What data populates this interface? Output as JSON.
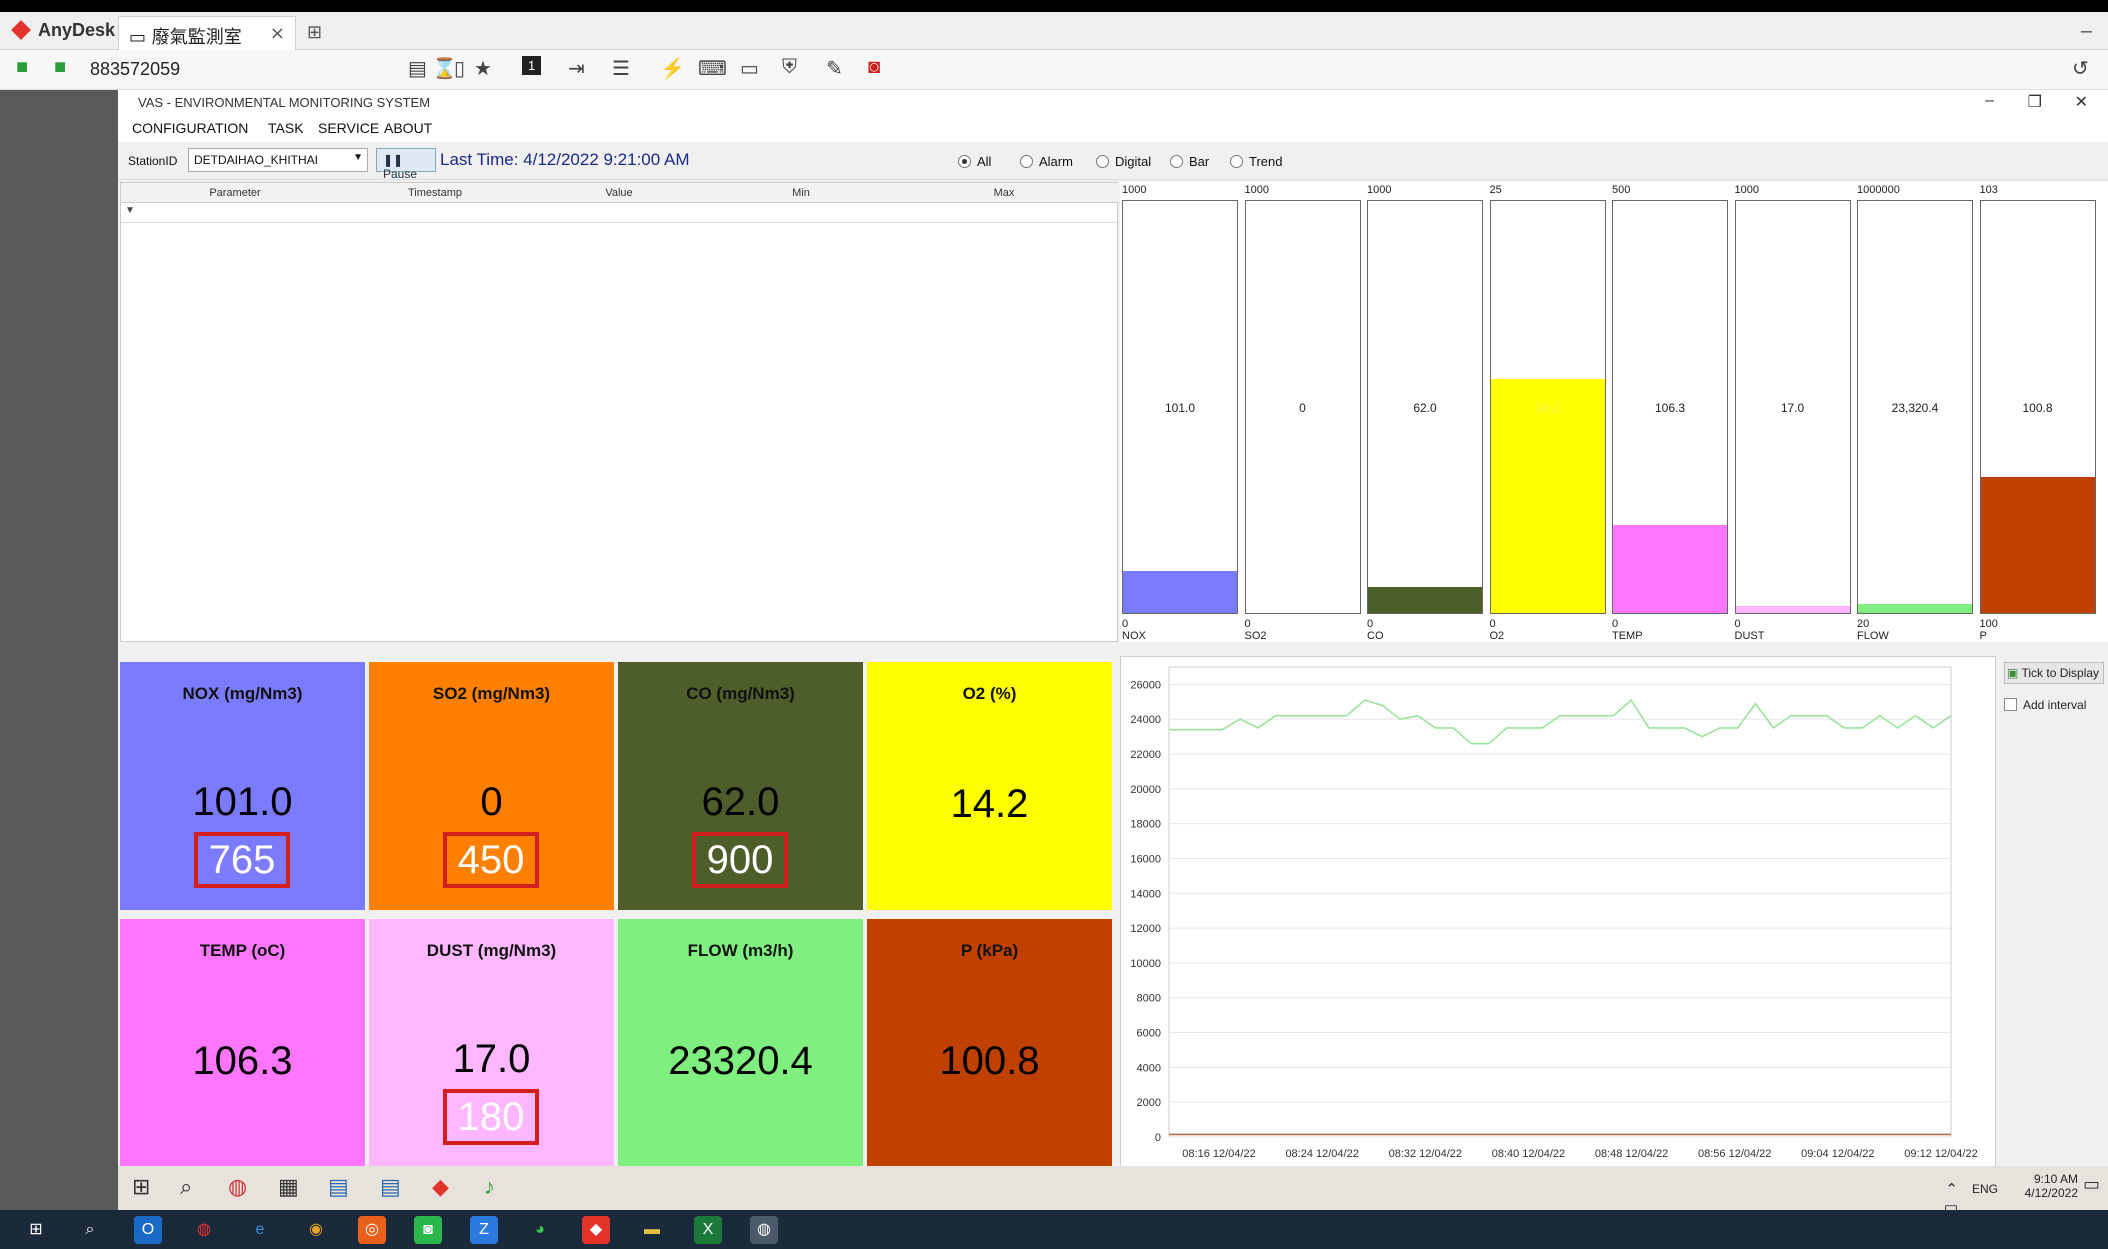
{
  "anydesk": {
    "app_name": "AnyDesk",
    "tab_title": "廢氣監測室",
    "tab_close": "×",
    "new_tab": "⊞",
    "address": "883572059",
    "minimize": "–"
  },
  "app": {
    "title": "VAS - ENVIRONMENTAL MONITORING SYSTEM",
    "menu": [
      "CONFIGURATION",
      "TASK",
      "SERVICE",
      "ABOUT"
    ],
    "station_label": "StationID",
    "station_value": "DETDAIHAO_KHITHAI",
    "pause_label": "Pause",
    "last_time": "Last Time: 4/12/2022 9:21:00 AM",
    "radios": [
      {
        "label": "All",
        "checked": true
      },
      {
        "label": "Alarm",
        "checked": false
      },
      {
        "label": "Digital",
        "checked": false
      },
      {
        "label": "Bar",
        "checked": false
      },
      {
        "label": "Trend",
        "checked": false
      }
    ]
  },
  "grid": {
    "columns": [
      "Parameter",
      "Timestamp",
      "Value",
      "Min",
      "Max"
    ],
    "filter_icon": "▼"
  },
  "bars": [
    {
      "name": "NOX",
      "max": "1000",
      "min": "0",
      "value": "101.0",
      "fraction": 0.101,
      "color": "#7b7bff"
    },
    {
      "name": "SO2",
      "max": "1000",
      "min": "0",
      "value": "0",
      "fraction": 0,
      "color": "#ff8000"
    },
    {
      "name": "CO",
      "max": "1000",
      "min": "0",
      "value": "62.0",
      "fraction": 0.062,
      "color": "#4e5e2a"
    },
    {
      "name": "O2",
      "max": "25",
      "min": "0",
      "value": "14.2",
      "fraction": 0.568,
      "color": "#ffff00"
    },
    {
      "name": "TEMP",
      "max": "500",
      "min": "0",
      "value": "106.3",
      "fraction": 0.213,
      "color": "#ff77ff"
    },
    {
      "name": "DUST",
      "max": "1000",
      "min": "0",
      "value": "17.0",
      "fraction": 0.017,
      "color": "#ffb7ff"
    },
    {
      "name": "FLOW",
      "max": "1000000",
      "min": "20",
      "value": "23,320.4",
      "fraction": 0.023,
      "color": "#7ff07f"
    },
    {
      "name": "P",
      "max": "103",
      "min": "100",
      "value": "100.8",
      "fraction": 0.33,
      "color": "#c04000"
    }
  ],
  "tiles": [
    {
      "title": "NOX (mg/Nm3)",
      "value": "101.0",
      "limit": "765",
      "color": "#7b7bff"
    },
    {
      "title": "SO2 (mg/Nm3)",
      "value": "0",
      "limit": "450",
      "color": "#ff8000"
    },
    {
      "title": "CO (mg/Nm3)",
      "value": "62.0",
      "limit": "900",
      "color": "#4e5e2a"
    },
    {
      "title": "O2 (%)",
      "value": "14.2",
      "limit": "",
      "color": "#ffff00"
    },
    {
      "title": "TEMP (oC)",
      "value": "106.3",
      "limit": "",
      "color": "#ff77ff"
    },
    {
      "title": "DUST (mg/Nm3)",
      "value": "17.0",
      "limit": "180",
      "color": "#ffb7ff"
    },
    {
      "title": "FLOW (m3/h)",
      "value": "23320.4",
      "limit": "",
      "color": "#7ff07f"
    },
    {
      "title": "P (kPa)",
      "value": "100.8",
      "limit": "",
      "color": "#c04000"
    }
  ],
  "trend": {
    "tick_to_display": "Tick to Display",
    "add_interval": "Add interval"
  },
  "chart_data": {
    "type": "line",
    "ylim": [
      0,
      27000
    ],
    "y_ticks": [
      "0",
      "2000",
      "4000",
      "6000",
      "8000",
      "10000",
      "12000",
      "14000",
      "16000",
      "18000",
      "20000",
      "22000",
      "24000",
      "26000"
    ],
    "x_ticks": [
      "08:16 12/04/22",
      "08:24 12/04/22",
      "08:32 12/04/22",
      "08:40 12/04/22",
      "08:48 12/04/22",
      "08:56 12/04/22",
      "09:04 12/04/22",
      "09:12 12/04/22"
    ],
    "series": [
      {
        "color": "#9be39b",
        "values": [
          23400,
          23400,
          23400,
          23400,
          24000,
          23500,
          24200,
          24200,
          24200,
          24200,
          24200,
          25100,
          24800,
          24000,
          24200,
          23500,
          23500,
          22600,
          22600,
          23500,
          23500,
          23500,
          24200,
          24200,
          24200,
          24200,
          25100,
          23500,
          23500,
          23500,
          23000,
          23500,
          23500,
          24900,
          23500,
          24200,
          24200,
          24200,
          23500,
          23500,
          24200,
          23500,
          24200,
          23500,
          24200
        ]
      },
      {
        "color": "#b86a4a",
        "values": [
          150,
          150,
          150,
          150,
          150,
          150,
          150,
          150,
          150,
          150,
          150,
          150,
          150,
          150,
          150,
          150,
          150,
          150,
          150,
          150,
          150,
          150,
          150,
          150,
          150,
          150,
          150,
          150,
          150,
          150,
          150,
          150,
          150,
          150,
          150,
          150,
          150,
          150,
          150,
          150,
          150,
          150,
          150,
          150,
          150
        ]
      }
    ]
  },
  "inner_taskbar": {
    "time": "9:10 AM",
    "date": "4/12/2022",
    "lang": "ENG"
  }
}
